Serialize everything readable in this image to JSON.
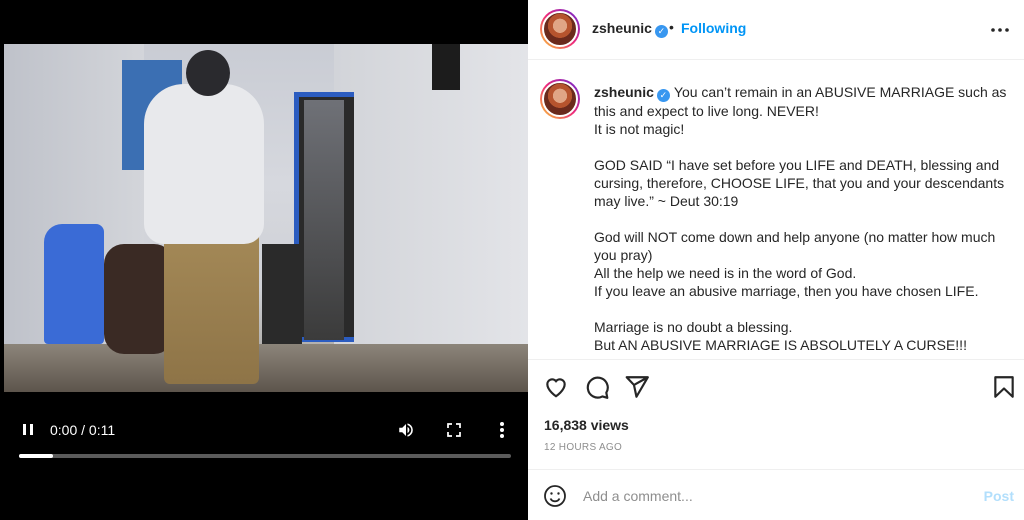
{
  "video": {
    "time_display": "0:00 / 0:11",
    "progress_fraction": 0.07,
    "icons": {
      "pause": "pause-icon",
      "volume": "volume-icon",
      "fullscreen": "fullscreen-icon",
      "more": "more-vertical-icon"
    }
  },
  "header": {
    "username": "zsheunic",
    "separator": "•",
    "follow_status": "Following",
    "more_icon": "more-horizontal-icon"
  },
  "caption": {
    "username": "zsheunic",
    "lines": [
      "You can’t remain in an ABUSIVE MARRIAGE such as this and expect to live long. NEVER!",
      "It is not magic!",
      "",
      "GOD SAID “I have set before you LIFE and DEATH, blessing and cursing, therefore, CHOOSE LIFE, that you and your descendants may live.” ~ Deut 30:19",
      "",
      "God will NOT come down and help anyone (no matter how much you pray)",
      "All the help we need is in the word of God.",
      "If you leave an abusive marriage, then you have chosen LIFE.",
      "",
      "Marriage is no doubt a blessing.",
      "But AN ABUSIVE MARRIAGE IS ABSOLUTELY A CURSE!!!"
    ]
  },
  "actions": {
    "views": "16,838 views",
    "timestamp": "12 HOURS AGO",
    "icons": [
      "heart-icon",
      "comment-icon",
      "share-icon",
      "bookmark-icon"
    ]
  },
  "comment_box": {
    "placeholder": "Add a comment...",
    "post_label": "Post",
    "emoji_icon": "smiley-icon"
  },
  "colors": {
    "link_blue": "#0095f6",
    "post_disabled": "#b2dffc",
    "verified_blue": "#3897f0"
  }
}
